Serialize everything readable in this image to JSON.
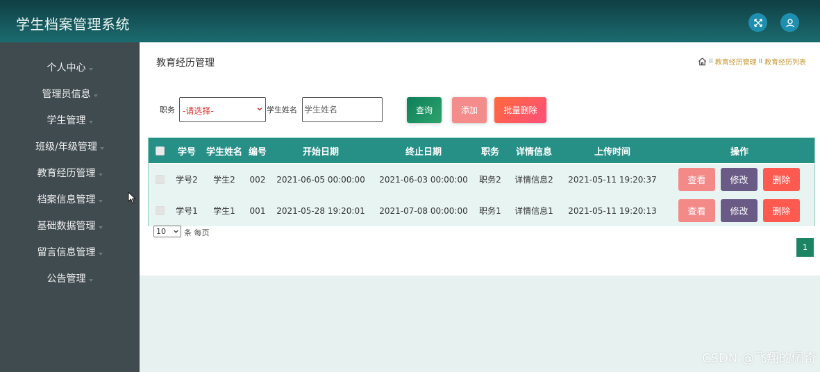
{
  "header": {
    "title": "学生档案管理系统"
  },
  "sidebar": {
    "items": [
      {
        "label": "个人中心"
      },
      {
        "label": "管理员信息"
      },
      {
        "label": "学生管理"
      },
      {
        "label": "班级/年级管理"
      },
      {
        "label": "教育经历管理"
      },
      {
        "label": "档案信息管理"
      },
      {
        "label": "基础数据管理"
      },
      {
        "label": "留言信息管理"
      },
      {
        "label": "公告管理"
      }
    ]
  },
  "page": {
    "title": "教育经历管理",
    "breadcrumb": [
      "教育经历管理",
      "教育经历列表"
    ],
    "breadcrumb_sep": "II"
  },
  "search": {
    "position_label": "职务",
    "position_select": "-请选择-",
    "name_label": "学生姓名",
    "name_placeholder": "学生姓名",
    "query_label": "查询",
    "add_label": "添加",
    "batch_delete_label": "批量删除"
  },
  "table": {
    "columns": [
      "学号",
      "学生姓名",
      "编号",
      "开始日期",
      "终止日期",
      "职务",
      "详情信息",
      "上传时间",
      "操作"
    ],
    "rows": [
      {
        "student_no": "学号2",
        "name": "学生2",
        "code": "002",
        "start": "2021-06-05 00:00:00",
        "end": "2021-06-03 00:00:00",
        "position": "职务2",
        "detail": "详情信息2",
        "uploaded": "2021-05-11 19:20:37"
      },
      {
        "student_no": "学号1",
        "name": "学生1",
        "code": "001",
        "start": "2021-05-28 19:20:01",
        "end": "2021-07-08 00:00:00",
        "position": "职务1",
        "detail": "详情信息1",
        "uploaded": "2021-05-11 19:20:13"
      }
    ],
    "actions": {
      "view": "查看",
      "edit": "修改",
      "delete": "删除"
    }
  },
  "pagination": {
    "page_size": "10",
    "per_page_label": "条 每页",
    "current_page": "1"
  },
  "watermark": "CSDN @飞翔的佩奇",
  "colors": {
    "header": "#1b6b6f",
    "sidebar": "#404b50",
    "table_header": "#268f86",
    "accent": "#1c8463"
  }
}
